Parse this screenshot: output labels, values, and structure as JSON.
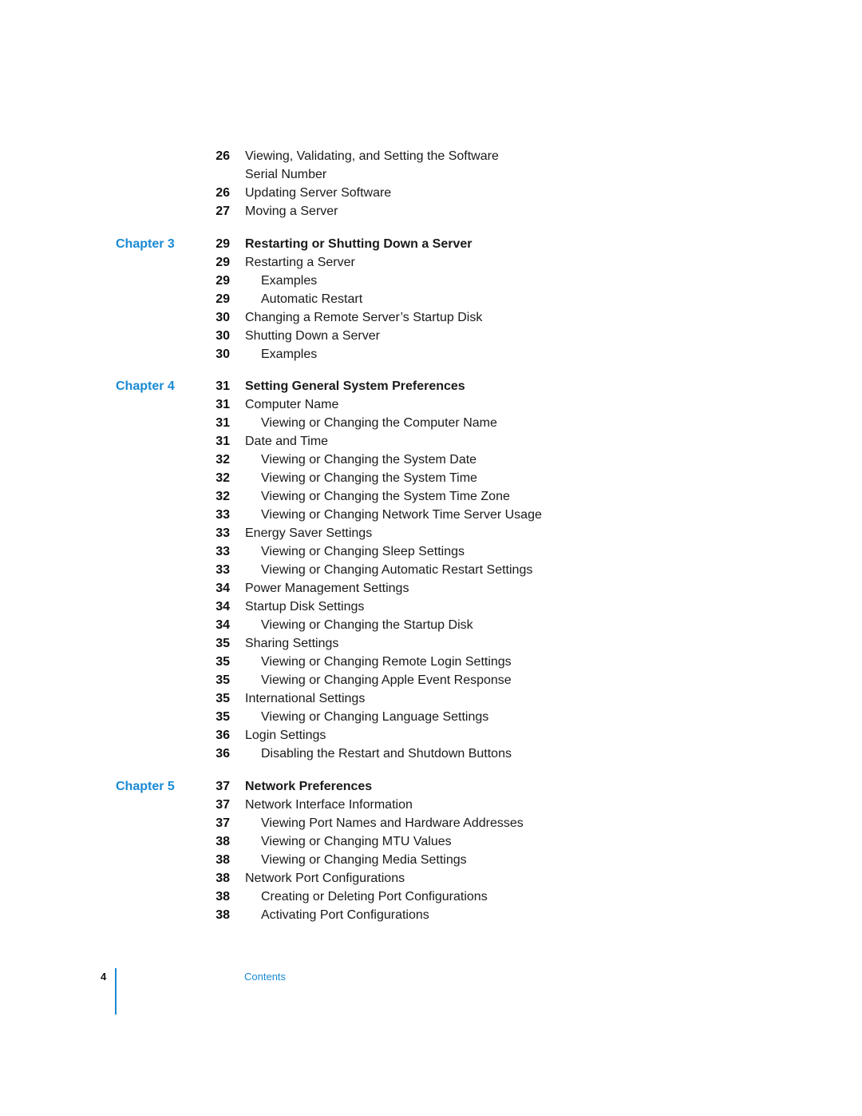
{
  "accent_color": "#1a8ad4",
  "sections": [
    {
      "chapter": "",
      "entries": [
        {
          "page": "26",
          "title": "Viewing, Validating, and Setting the Software",
          "level": 2
        },
        {
          "page": "",
          "title": "Serial Number",
          "level": 2,
          "continuation": true
        },
        {
          "page": "26",
          "title": "Updating Server Software",
          "level": 2
        },
        {
          "page": "27",
          "title": "Moving a Server",
          "level": 2
        }
      ]
    },
    {
      "chapter": "Chapter 3",
      "entries": [
        {
          "page": "29",
          "title": "Restarting or Shutting Down a Server",
          "level": 1
        },
        {
          "page": "29",
          "title": "Restarting a Server",
          "level": 2
        },
        {
          "page": "29",
          "title": "Examples",
          "level": 3
        },
        {
          "page": "29",
          "title": "Automatic Restart",
          "level": 3
        },
        {
          "page": "30",
          "title": "Changing a Remote Server’s Startup Disk",
          "level": 2
        },
        {
          "page": "30",
          "title": "Shutting Down a Server",
          "level": 2
        },
        {
          "page": "30",
          "title": "Examples",
          "level": 3
        }
      ]
    },
    {
      "chapter": "Chapter 4",
      "entries": [
        {
          "page": "31",
          "title": "Setting General System Preferences",
          "level": 1
        },
        {
          "page": "31",
          "title": "Computer Name",
          "level": 2
        },
        {
          "page": "31",
          "title": "Viewing or Changing the Computer Name",
          "level": 3
        },
        {
          "page": "31",
          "title": "Date and Time",
          "level": 2
        },
        {
          "page": "32",
          "title": "Viewing or Changing the System Date",
          "level": 3
        },
        {
          "page": "32",
          "title": "Viewing or Changing the System Time",
          "level": 3
        },
        {
          "page": "32",
          "title": "Viewing or Changing the System Time Zone",
          "level": 3
        },
        {
          "page": "33",
          "title": "Viewing or Changing Network Time Server Usage",
          "level": 3
        },
        {
          "page": "33",
          "title": "Energy Saver Settings",
          "level": 2
        },
        {
          "page": "33",
          "title": "Viewing or Changing Sleep Settings",
          "level": 3
        },
        {
          "page": "33",
          "title": "Viewing or Changing Automatic Restart Settings",
          "level": 3
        },
        {
          "page": "34",
          "title": "Power Management Settings",
          "level": 2
        },
        {
          "page": "34",
          "title": "Startup Disk Settings",
          "level": 2
        },
        {
          "page": "34",
          "title": "Viewing or Changing the Startup Disk",
          "level": 3
        },
        {
          "page": "35",
          "title": "Sharing Settings",
          "level": 2
        },
        {
          "page": "35",
          "title": "Viewing or Changing Remote Login Settings",
          "level": 3
        },
        {
          "page": "35",
          "title": "Viewing or Changing Apple Event Response",
          "level": 3
        },
        {
          "page": "35",
          "title": "International Settings",
          "level": 2
        },
        {
          "page": "35",
          "title": "Viewing or Changing Language Settings",
          "level": 3
        },
        {
          "page": "36",
          "title": "Login Settings",
          "level": 2
        },
        {
          "page": "36",
          "title": "Disabling the Restart and Shutdown Buttons",
          "level": 3
        }
      ]
    },
    {
      "chapter": "Chapter 5",
      "entries": [
        {
          "page": "37",
          "title": "Network Preferences",
          "level": 1
        },
        {
          "page": "37",
          "title": "Network Interface Information",
          "level": 2
        },
        {
          "page": "37",
          "title": "Viewing Port Names and Hardware Addresses",
          "level": 3
        },
        {
          "page": "38",
          "title": "Viewing or Changing MTU Values",
          "level": 3
        },
        {
          "page": "38",
          "title": "Viewing or Changing Media Settings",
          "level": 3
        },
        {
          "page": "38",
          "title": "Network Port Configurations",
          "level": 2
        },
        {
          "page": "38",
          "title": "Creating or Deleting Port Configurations",
          "level": 3
        },
        {
          "page": "38",
          "title": "Activating Port Configurations",
          "level": 3
        }
      ]
    }
  ],
  "footer": {
    "page_number": "4",
    "section_label": "Contents"
  }
}
